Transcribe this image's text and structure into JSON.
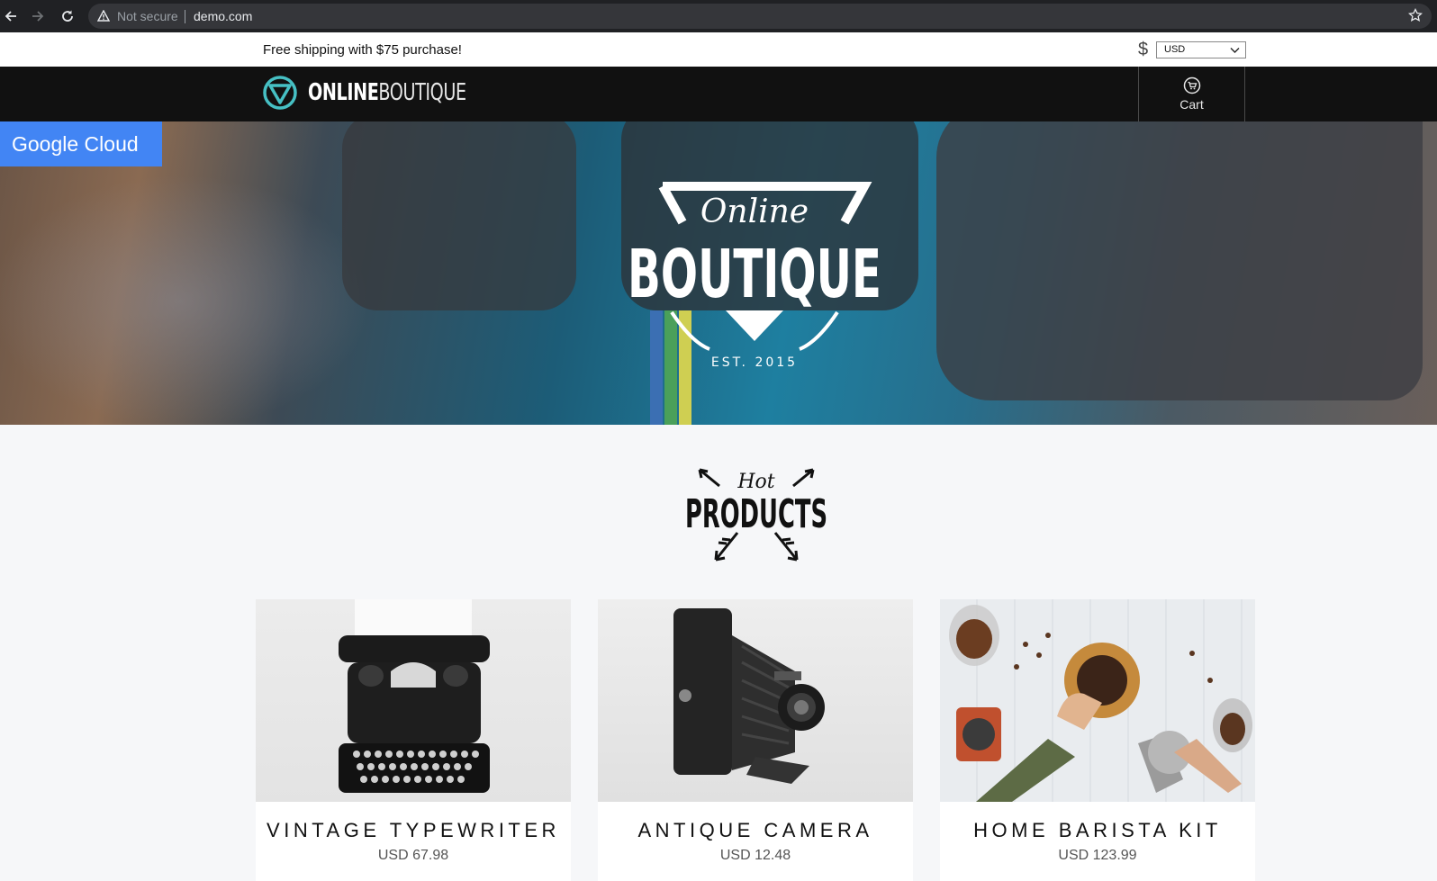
{
  "browser": {
    "security_label": "Not secure",
    "url": "demo.com"
  },
  "promo": {
    "text": "Free shipping with $75 purchase!"
  },
  "currency": {
    "symbol": "$",
    "selected": "USD"
  },
  "header": {
    "logo_bold": "ONLINE",
    "logo_light": "BOUTIQUE",
    "cart_label": "Cart"
  },
  "badge": {
    "label": "Google Cloud"
  },
  "hero": {
    "logo_script": "Online",
    "logo_main": "BOUTIQUE",
    "logo_est": "EST. 2015"
  },
  "section": {
    "hot_script": "Hot",
    "hot_main": "PRODUCTS"
  },
  "products": [
    {
      "name": "VINTAGE TYPEWRITER",
      "price": "USD 67.98",
      "image": "typewriter"
    },
    {
      "name": "ANTIQUE CAMERA",
      "price": "USD 12.48",
      "image": "camera"
    },
    {
      "name": "HOME BARISTA KIT",
      "price": "USD 123.99",
      "image": "barista-kit"
    }
  ],
  "colors": {
    "accent_teal": "#46c0c4",
    "header_bg": "#111111",
    "gc_blue": "#4285f4",
    "page_bg": "#f6f7f9"
  }
}
